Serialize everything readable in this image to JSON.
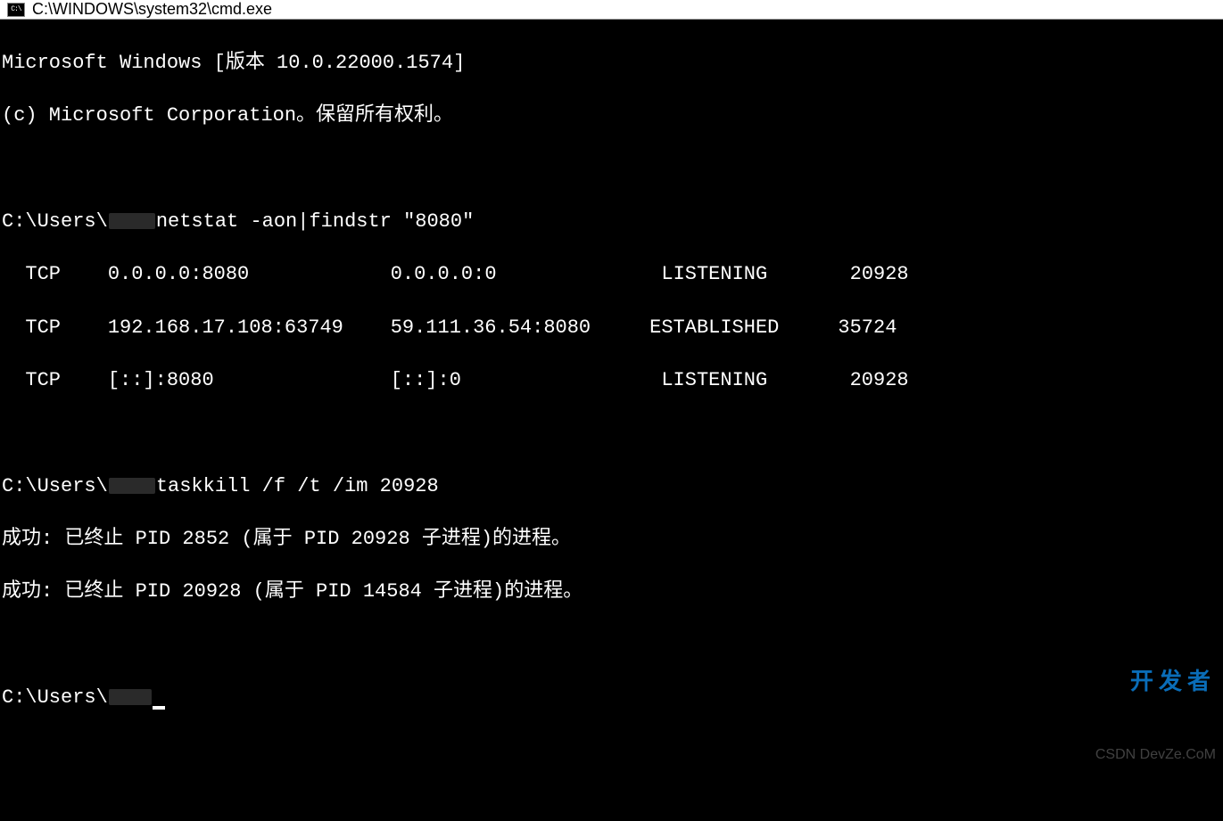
{
  "titlebar": {
    "icon_label": "C:\\",
    "title": "C:\\WINDOWS\\system32\\cmd.exe"
  },
  "terminal": {
    "banner_line1": "Microsoft Windows [版本 10.0.22000.1574]",
    "banner_line2": "(c) Microsoft Corporation。保留所有权利。",
    "prompt_base": "C:\\Users\\",
    "cmd1": "netstat -aon|findstr \"8080\"",
    "netstat": [
      {
        "proto": "TCP",
        "local": "0.0.0.0:8080",
        "foreign": "0.0.0.0:0",
        "state": "LISTENING",
        "pid": "20928"
      },
      {
        "proto": "TCP",
        "local": "192.168.17.108:63749",
        "foreign": "59.111.36.54:8080",
        "state": "ESTABLISHED",
        "pid": "35724"
      },
      {
        "proto": "TCP",
        "local": "[::]:8080",
        "foreign": "[::]:0",
        "state": "LISTENING",
        "pid": "20928"
      }
    ],
    "cmd2": "taskkill /f /t /im 20928",
    "kill_result1": "成功: 已终止 PID 2852 (属于 PID 20928 子进程)的进程。",
    "kill_result2": "成功: 已终止 PID 20928 (属于 PID 14584 子进程)的进程。"
  },
  "watermark": {
    "main": "开发者",
    "sub": "CSDN DevZe.CoM"
  }
}
